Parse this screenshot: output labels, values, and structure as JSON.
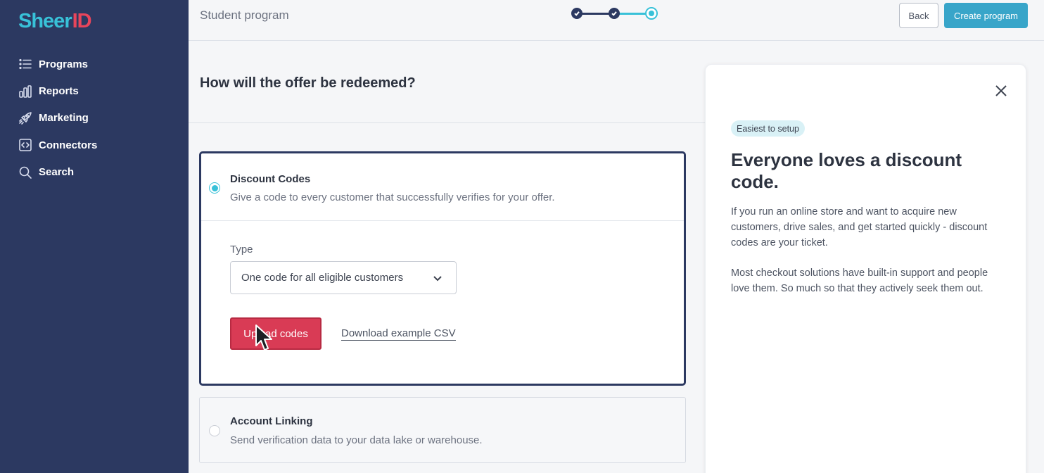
{
  "brand": {
    "logo_part1": "Sheer",
    "logo_part2": "ID",
    "colors": {
      "sidebar": "#2c3961",
      "accent": "#38c1d8",
      "danger": "#d93b55"
    }
  },
  "sidebar": {
    "items": [
      {
        "label": "Programs",
        "icon": "list-icon"
      },
      {
        "label": "Reports",
        "icon": "bar-chart-icon"
      },
      {
        "label": "Marketing",
        "icon": "rocket-icon"
      },
      {
        "label": "Connectors",
        "icon": "code-icon"
      },
      {
        "label": "Search",
        "icon": "search-icon"
      }
    ]
  },
  "header": {
    "title": "Student program",
    "stepper": {
      "total_steps": 3,
      "current_step": 3
    },
    "back_label": "Back",
    "create_label": "Create program"
  },
  "main": {
    "question": "How will the offer be redeemed?",
    "options": [
      {
        "title": "Discount Codes",
        "description": "Give a code to every customer that successfully verifies for your offer.",
        "selected": true,
        "type_label": "Type",
        "type_value": "One code for all eligible customers",
        "upload_label": "Upload codes",
        "csv_link_label": "Download example CSV"
      },
      {
        "title": "Account Linking",
        "description": "Send verification data to your data lake or warehouse.",
        "selected": false
      }
    ]
  },
  "info_panel": {
    "badge": "Easiest to setup",
    "headline": "Everyone loves a discount code.",
    "paragraphs": [
      "If you run an online store and want to acquire new customers, drive sales, and get started quickly - discount codes are your ticket.",
      "Most checkout solutions have built-in support and people love them. So much so that they actively seek them out."
    ]
  }
}
